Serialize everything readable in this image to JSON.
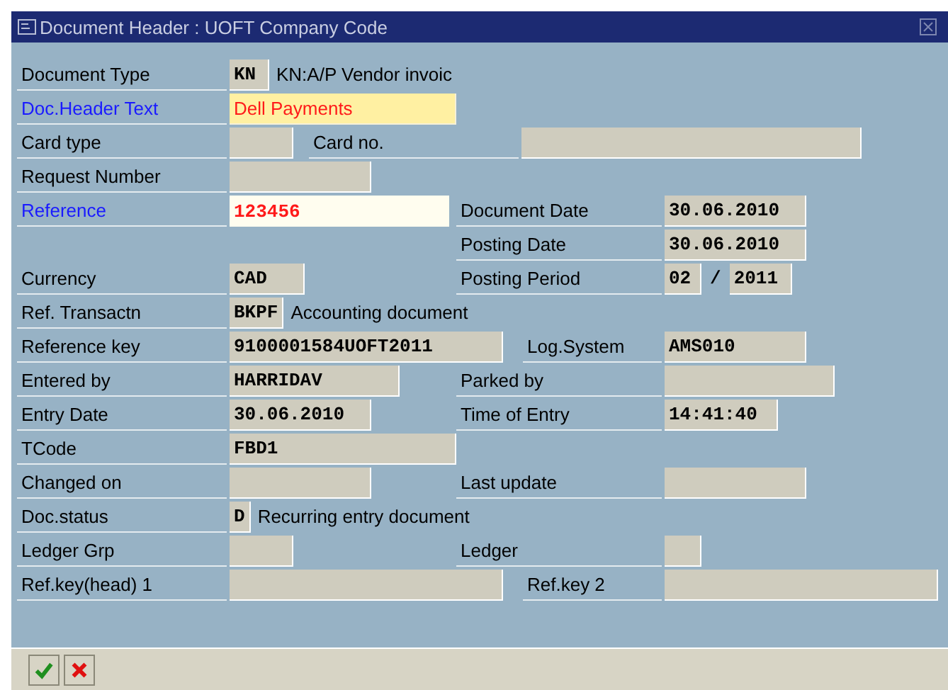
{
  "window": {
    "title": "Document Header : UOFT Company Code"
  },
  "rows": [
    {
      "left": {
        "label": "Document Type",
        "required": false,
        "field": {
          "value": "KN",
          "kind": "display"
        },
        "description": "KN:A/P Vendor invoic"
      }
    },
    {
      "left": {
        "label": "Doc.Header Text",
        "required": true,
        "field": {
          "value": "Dell Payments",
          "kind": "highlighted"
        }
      }
    },
    {
      "left": {
        "label": "Card type",
        "required": false,
        "field": {
          "kind": "display"
        }
      },
      "right": {
        "label": "Card no.",
        "field": {
          "kind": "display"
        }
      }
    },
    {
      "left": {
        "label": "Request Number",
        "required": false,
        "field": {
          "kind": "display"
        }
      }
    },
    {
      "left": {
        "label": "Reference",
        "required": true,
        "field": {
          "value": "123456",
          "kind": "input"
        }
      },
      "right": {
        "label": "Document Date",
        "field": {
          "value": "30.06.2010",
          "kind": "display"
        }
      }
    },
    {
      "right": {
        "label": "Posting Date",
        "field": {
          "value": "30.06.2010",
          "kind": "display"
        }
      }
    },
    {
      "left": {
        "label": "Currency",
        "required": false,
        "field": {
          "value": "CAD",
          "kind": "display"
        }
      },
      "right": {
        "label": "Posting Period",
        "field": {
          "value": "02",
          "kind": "display"
        },
        "separator": "/",
        "field_2": {
          "value": "2011",
          "kind": "display"
        }
      }
    },
    {
      "left": {
        "label": "Ref. Transactn",
        "required": false,
        "field": {
          "value": "BKPF",
          "kind": "display"
        },
        "description": "Accounting document"
      }
    },
    {
      "left": {
        "label": "Reference key",
        "required": false,
        "field": {
          "value": "9100001584UOFT2011",
          "kind": "display"
        }
      },
      "right": {
        "label": "Log.System",
        "field": {
          "value": "AMS010",
          "kind": "display"
        }
      }
    },
    {
      "left": {
        "label": "Entered by",
        "required": false,
        "field": {
          "value": "HARRIDAV",
          "kind": "display"
        }
      },
      "right": {
        "label": "Parked by",
        "field": {
          "kind": "display"
        }
      }
    },
    {
      "left": {
        "label": "Entry Date",
        "required": false,
        "field": {
          "value": "30.06.2010",
          "kind": "display"
        }
      },
      "right": {
        "label": "Time of Entry",
        "field": {
          "value": "14:41:40",
          "kind": "display"
        }
      }
    },
    {
      "left": {
        "label": "TCode",
        "required": false,
        "field": {
          "value": "FBD1",
          "kind": "display"
        }
      }
    },
    {
      "left": {
        "label": "Changed on",
        "required": false,
        "field": {
          "kind": "display"
        }
      },
      "right": {
        "label": "Last update",
        "field": {
          "kind": "display"
        }
      }
    },
    {
      "left": {
        "label": "Doc.status",
        "required": false,
        "field": {
          "value": "D",
          "kind": "display"
        },
        "description": "Recurring entry document"
      }
    },
    {
      "left": {
        "label": "Ledger Grp",
        "required": false,
        "field": {
          "kind": "display"
        }
      },
      "right": {
        "label": "Ledger",
        "field": {
          "kind": "display"
        }
      }
    },
    {
      "left": {
        "label": "Ref.key(head) 1",
        "required": false,
        "field": {
          "kind": "display"
        }
      },
      "right": {
        "label": "Ref.key 2",
        "field": {
          "kind": "display"
        }
      }
    }
  ],
  "buttons": [
    {
      "kind": "confirm"
    },
    {
      "kind": "cancel"
    }
  ]
}
